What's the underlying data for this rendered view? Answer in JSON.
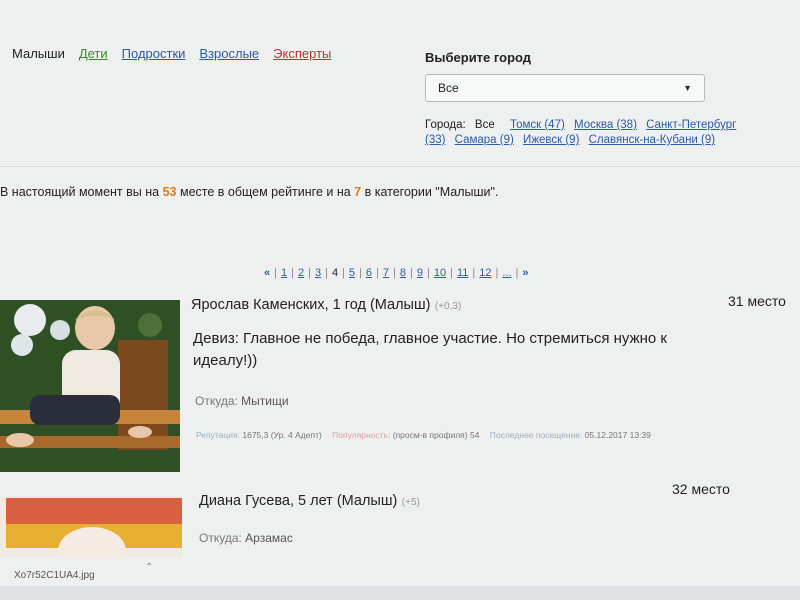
{
  "categories": [
    "Малыши",
    "Дети",
    "Подростки",
    "Взрослые",
    "Эксперты"
  ],
  "city": {
    "title": "Выберите город",
    "selected": "Все",
    "list_label": "Города:",
    "all_label": "Все",
    "cities": [
      "Томск (47)",
      "Москва (38)",
      "Санкт-Петербург (33)",
      "Самара (9)",
      "Ижевск (9)",
      "Славянск-на-Кубани (9)"
    ]
  },
  "rating": {
    "prefix": "В настоящий момент вы на",
    "overall": "53",
    "middle": "месте в общем рейтинге и на",
    "category_place": "7",
    "suffix": "в категории \"Малыши\"."
  },
  "pager": {
    "first": "«",
    "pages": [
      "1",
      "2",
      "3",
      "4",
      "5",
      "6",
      "7",
      "8",
      "9",
      "10",
      "11",
      "12",
      "..."
    ],
    "current": "4",
    "next": "»"
  },
  "entries": [
    {
      "name": "Ярослав Каменских, 1 год (Малыш)",
      "delta": "(+0,3)",
      "place": "31 место",
      "motto": "Девиз: Главное не победа, главное участие. Но стремиться нужно к идеалу!))",
      "from_label": "Откуда:",
      "from_value": "Мытищи",
      "reputation_label": "Репутация:",
      "reputation_value": "1675,3 (Ур. 4 Адепт)",
      "popularity_label": "Популярность:",
      "views": "(просм-в профиля) 54",
      "last_label": "Последнее посещение:",
      "last_value": "05.12.2017 13:39"
    },
    {
      "name": "Диана Гусева, 5 лет (Малыш)",
      "delta": "(+5)",
      "place": "32 место",
      "from_label": "Откуда:",
      "from_value": "Арзамас"
    }
  ],
  "footer_file": "Xo7r52C1UA4.jpg",
  "colors": {
    "link": "#2a5aa8",
    "accent": "#e07820",
    "green": "#3a8a2a",
    "red": "#c03030"
  }
}
